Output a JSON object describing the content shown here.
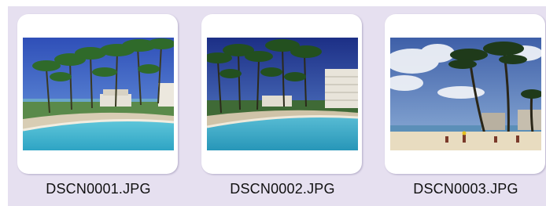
{
  "thumbnails": [
    {
      "filename": "DSCN0001.JPG"
    },
    {
      "filename": "DSCN0002.JPG"
    },
    {
      "filename": "DSCN0003.JPG"
    }
  ]
}
